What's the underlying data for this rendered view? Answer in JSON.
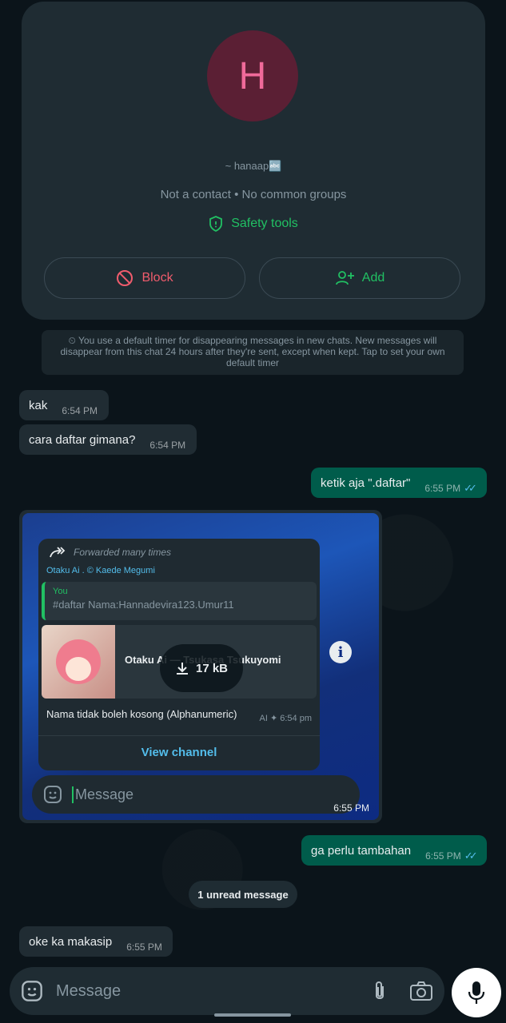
{
  "contact": {
    "avatar_letter": "H",
    "handle": "~ hanaap🔤",
    "subtitle": "Not a contact • No common groups",
    "safety_label": "Safety tools",
    "block_label": "Block",
    "add_label": "Add"
  },
  "notice": "⏲ You use a default timer for disappearing messages in new chats. New messages will disappear from this chat 24 hours after they're sent, except when kept. Tap to set your own default timer",
  "messages": [
    {
      "text": "kak",
      "time": "6:54 PM",
      "dir": "in"
    },
    {
      "text": "cara daftar gimana?",
      "time": "6:54 PM",
      "dir": "in"
    },
    {
      "text": "ketik aja \".daftar\"",
      "time": "6:55 PM",
      "dir": "out"
    },
    {
      "text": "ga perlu tambahan",
      "time": "6:55 PM",
      "dir": "out"
    },
    {
      "text": "oke ka makasip",
      "time": "6:55 PM",
      "dir": "in"
    }
  ],
  "image_message": {
    "forwarded_label": "Forwarded many times",
    "source": "Otaku Ai . © Kaede Megumi",
    "quote_author": "You",
    "quote_text": "#daftar Nama:Hannadevira123.Umur11",
    "preview_title": "Otaku Ai — Tsukasa Tsukuyomi",
    "download_size": "17 kB",
    "message_text": "Nama tidak boleh kosong (Alphanumeric)",
    "meta": "AI ✦ 6:54 pm",
    "view_channel": "View channel",
    "inner_placeholder": "Message",
    "time": "6:55 PM"
  },
  "unread_label": "1 unread message",
  "input": {
    "placeholder": "Message"
  },
  "colors": {
    "accent": "#21c063",
    "danger": "#f15c6d",
    "bubble_out": "#005c4b",
    "bubble_in": "#202c33"
  }
}
